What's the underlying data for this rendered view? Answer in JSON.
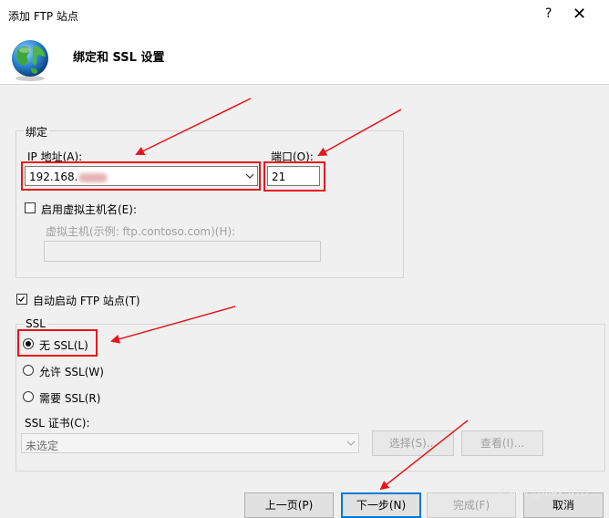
{
  "window": {
    "title": "添加 FTP 站点",
    "help": "?",
    "close": "✕"
  },
  "header": {
    "title": "绑定和 SSL 设置",
    "icon": "globe-icon"
  },
  "binding": {
    "group_label": "绑定",
    "ip_label": "IP 地址(A):",
    "ip_value": "192.168.",
    "port_label": "端口(O):",
    "port_value": "21",
    "virtual_host_checkbox_label": "启用虚拟主机名(E):",
    "virtual_host_checked": false,
    "virtual_host_hint": "虚拟主机(示例: ftp.contoso.com)(H):",
    "virtual_host_value": ""
  },
  "autostart": {
    "label": "自动启动 FTP 站点(T)",
    "checked": true
  },
  "ssl": {
    "group_label": "SSL",
    "options": [
      "无 SSL(L)",
      "允许 SSL(W)",
      "需要 SSL(R)"
    ],
    "selected_index": 0,
    "cert_label": "SSL 证书(C):",
    "cert_value": "未选定",
    "select_button": "选择(S)...",
    "view_button": "查看(I)..."
  },
  "footer": {
    "prev": "上一页(P)",
    "next": "下一步(N)",
    "finish": "完成(F)",
    "cancel": "取消"
  },
  "watermark": "CSDN @Alex_81D",
  "annotation_color": "#e8141b"
}
